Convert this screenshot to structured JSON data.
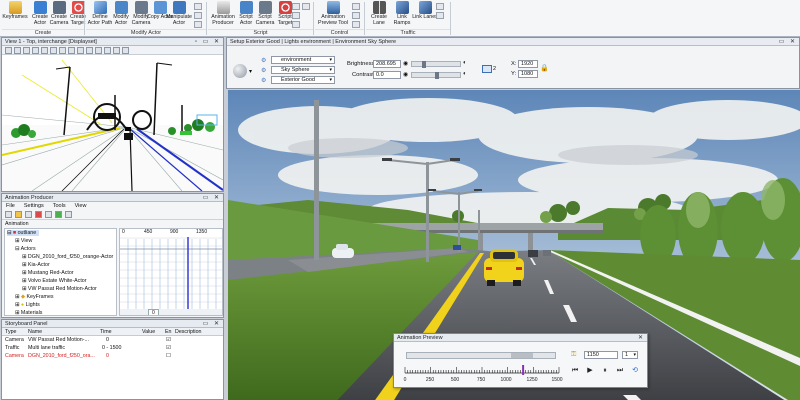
{
  "ribbon": {
    "buttons": [
      {
        "label": "Keyframes",
        "icon": "keyframes-icon"
      },
      {
        "label": "Create Actor",
        "icon": "create-actor-icon"
      },
      {
        "label": "Create Camera",
        "icon": "create-camera-icon"
      },
      {
        "label": "Create Target",
        "icon": "create-target-icon"
      },
      {
        "label": "Define Actor Path",
        "icon": "define-path-icon"
      },
      {
        "label": "Modify Actor",
        "icon": "modify-actor-icon"
      },
      {
        "label": "Modify Camera",
        "icon": "modify-camera-icon"
      },
      {
        "label": "Copy Actor",
        "icon": "copy-actor-icon"
      },
      {
        "label": "Manipulate Actor",
        "icon": "manipulate-actor-icon"
      },
      {
        "label": "Animation Producer",
        "icon": "animation-producer-icon"
      },
      {
        "label": "Script Actor",
        "icon": "script-actor-icon"
      },
      {
        "label": "Script Camera",
        "icon": "script-camera-icon"
      },
      {
        "label": "Script Target",
        "icon": "script-target-icon"
      },
      {
        "label": "Animation Preview Tool",
        "icon": "animation-preview-icon"
      },
      {
        "label": "Create Lane",
        "icon": "create-lane-icon"
      },
      {
        "label": "Link Ramps",
        "icon": "link-ramps-icon"
      },
      {
        "label": "Link Lanes",
        "icon": "link-lanes-icon"
      }
    ],
    "groups": [
      "Create",
      "Modify Actor",
      "Script",
      "Control",
      "Traffic"
    ]
  },
  "view1": {
    "title": "View 1 - Top, interchange [Displayset]"
  },
  "env": {
    "title": "Setup Exterior Good | Lights environment | Environment Sky Sphere",
    "combo1": "environment",
    "combo2": "Sky Sphere",
    "combo3": "Exterior Good",
    "brightness_label": "Brightness:",
    "brightness_value": "208.695",
    "contrast_label": "Contrast:",
    "contrast_value": "0.0",
    "x_label": "X:",
    "x_value": "1920",
    "y_label": "Y:",
    "y_value": "1080",
    "count": "2"
  },
  "animprod": {
    "title": "Animation Producer",
    "menu": [
      "File",
      "Settings",
      "Tools",
      "View"
    ],
    "section": "Animation",
    "tree": [
      "outliane",
      "View",
      "Actors",
      "DGN_2010_ford_f250_orange-Actor",
      "Kia-Actor",
      "Mustang Red-Actor",
      "Volvo Estate White-Actor",
      "VW Passat Red Motion-Actor",
      "KeyFrames",
      "Lights",
      "Materials"
    ],
    "timeline_ticks": [
      "0",
      "450",
      "900",
      "1350"
    ],
    "frame_value": "0"
  },
  "storyboard": {
    "title": "Storyboard Panel",
    "headers": [
      "Type",
      "Name",
      "Time",
      "Value",
      "En",
      "Description"
    ],
    "rows": [
      {
        "type": "Camera",
        "name": "VW Passat Red Motion-...",
        "time": "0"
      },
      {
        "type": "Traffic",
        "name": "Multi lane traffic",
        "time": "0 - 1500"
      },
      {
        "type": "Camera",
        "name": "DGN_2010_ford_f250_ora...",
        "time": "0"
      }
    ],
    "colors": {
      "error_row": "#d21f1f"
    }
  },
  "preview": {
    "title": "Animation Preview",
    "frame": "1150",
    "step": "1",
    "ticks": [
      "0",
      "250",
      "500",
      "750",
      "1000",
      "1250",
      "1500"
    ],
    "position": 0.767
  }
}
